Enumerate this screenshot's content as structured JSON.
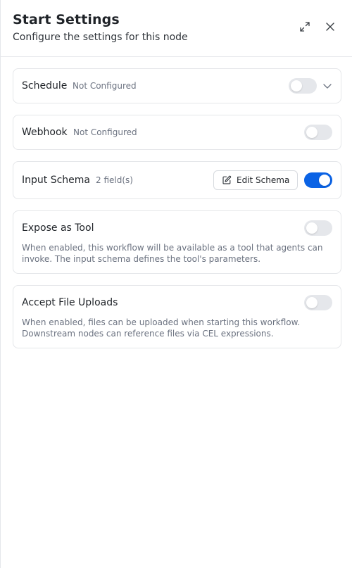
{
  "header": {
    "title": "Start Settings",
    "subtitle": "Configure the settings for this node",
    "expand_icon": "expand-icon",
    "close_icon": "close-icon"
  },
  "sections": {
    "schedule": {
      "title": "Schedule",
      "status": "Not Configured",
      "enabled": false,
      "expand_icon": "chevron-down-icon"
    },
    "webhook": {
      "title": "Webhook",
      "status": "Not Configured",
      "enabled": false
    },
    "input_schema": {
      "title": "Input Schema",
      "status": "2 field(s)",
      "edit_label": "Edit Schema",
      "edit_icon": "edit-icon",
      "enabled": true
    },
    "expose_as_tool": {
      "title": "Expose as Tool",
      "description": "When enabled, this workflow will be available as a tool that agents can invoke. The input schema defines the tool's parameters.",
      "enabled": false
    },
    "accept_file_uploads": {
      "title": "Accept File Uploads",
      "description": "When enabled, files can be uploaded when starting this workflow. Downstream nodes can reference files via CEL expressions.",
      "enabled": false
    }
  },
  "colors": {
    "toggle_on": "#0b63e5",
    "toggle_off": "#e5e7eb",
    "muted_text": "#6b7280"
  }
}
